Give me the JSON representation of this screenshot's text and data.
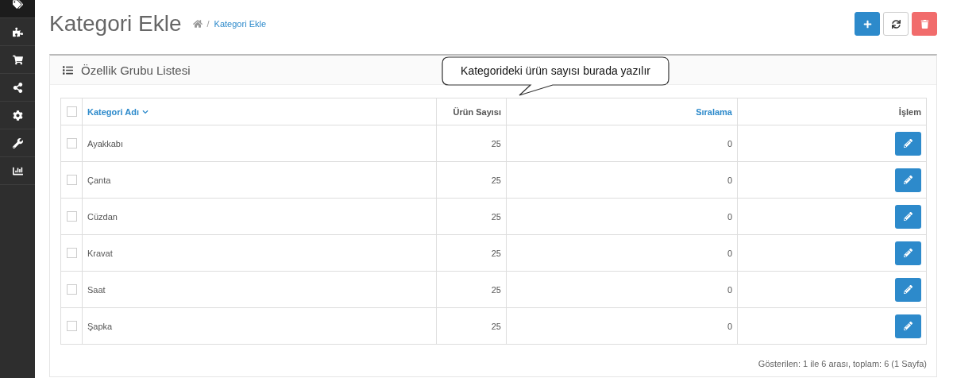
{
  "sidebar": {
    "items": [
      {
        "selected": true
      },
      {
        "selected": false
      },
      {
        "selected": false
      },
      {
        "selected": false
      },
      {
        "selected": false
      },
      {
        "selected": false
      },
      {
        "selected": false
      }
    ]
  },
  "page": {
    "title": "Kategori Ekle",
    "breadcrumb_separator": "/",
    "breadcrumb": [
      "Kategori Ekle"
    ]
  },
  "toolbar": [
    {
      "kind": "add"
    },
    {
      "kind": "refresh"
    },
    {
      "kind": "delete"
    }
  ],
  "panel": {
    "title": "Özellik Grubu Listesi"
  },
  "callout": {
    "text": "Kategorideki ürün sayısı burada yazılır"
  },
  "table": {
    "select_all": {
      "checked": false
    },
    "columns": [
      {
        "label": "Kategori Adı",
        "link": true,
        "sorted": true
      },
      {
        "label": "Ürün Sayısı",
        "link": false,
        "sorted": false
      },
      {
        "label": "Sıralama",
        "link": true,
        "sorted": false
      },
      {
        "label": "İşlem",
        "link": false,
        "sorted": false
      }
    ],
    "rows": [
      {
        "name": "Ayakkabı",
        "count": "25",
        "order": "0",
        "checked": false
      },
      {
        "name": "Çanta",
        "count": "25",
        "order": "0",
        "checked": false
      },
      {
        "name": "Cüzdan",
        "count": "25",
        "order": "0",
        "checked": false
      },
      {
        "name": "Kravat",
        "count": "25",
        "order": "0",
        "checked": false
      },
      {
        "name": "Saat",
        "count": "25",
        "order": "0",
        "checked": false
      },
      {
        "name": "Şapka",
        "count": "25",
        "order": "0",
        "checked": false
      }
    ]
  },
  "footer": {
    "text": "Gösterilen: 1 ile 6 arası, toplam: 6 (1 Sayfa)"
  }
}
